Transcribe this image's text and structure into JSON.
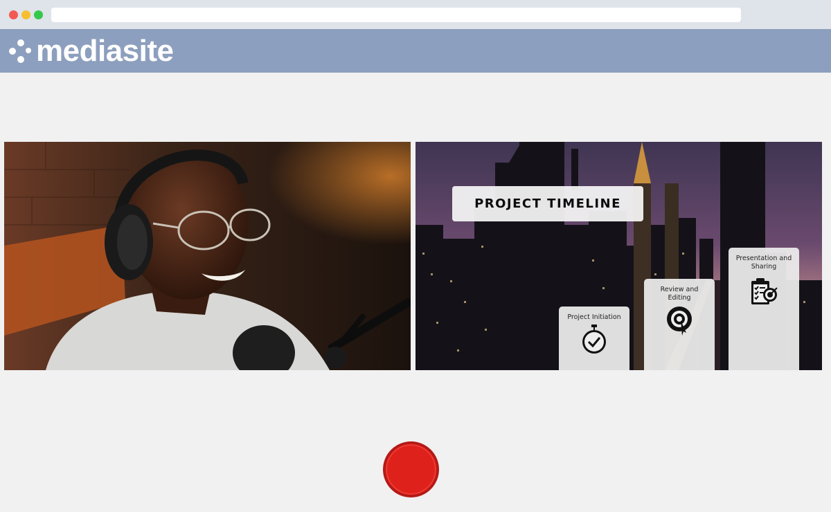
{
  "browser": {
    "address_bar": ""
  },
  "header": {
    "logo_text": "mediasite",
    "brand_color": "#8d9fbe"
  },
  "video": {
    "description_icon": "video-feed"
  },
  "slide": {
    "title": "PROJECT TIMELINE",
    "steps": [
      {
        "label": "Project Initiation",
        "icon": "stopwatch-icon"
      },
      {
        "label": "Review and Editing",
        "icon": "target-icon"
      },
      {
        "label": "Presentation and Sharing",
        "icon": "clipboard-target-icon"
      }
    ]
  },
  "controls": {
    "record_color": "#df211c",
    "record_icon": "record-icon"
  }
}
